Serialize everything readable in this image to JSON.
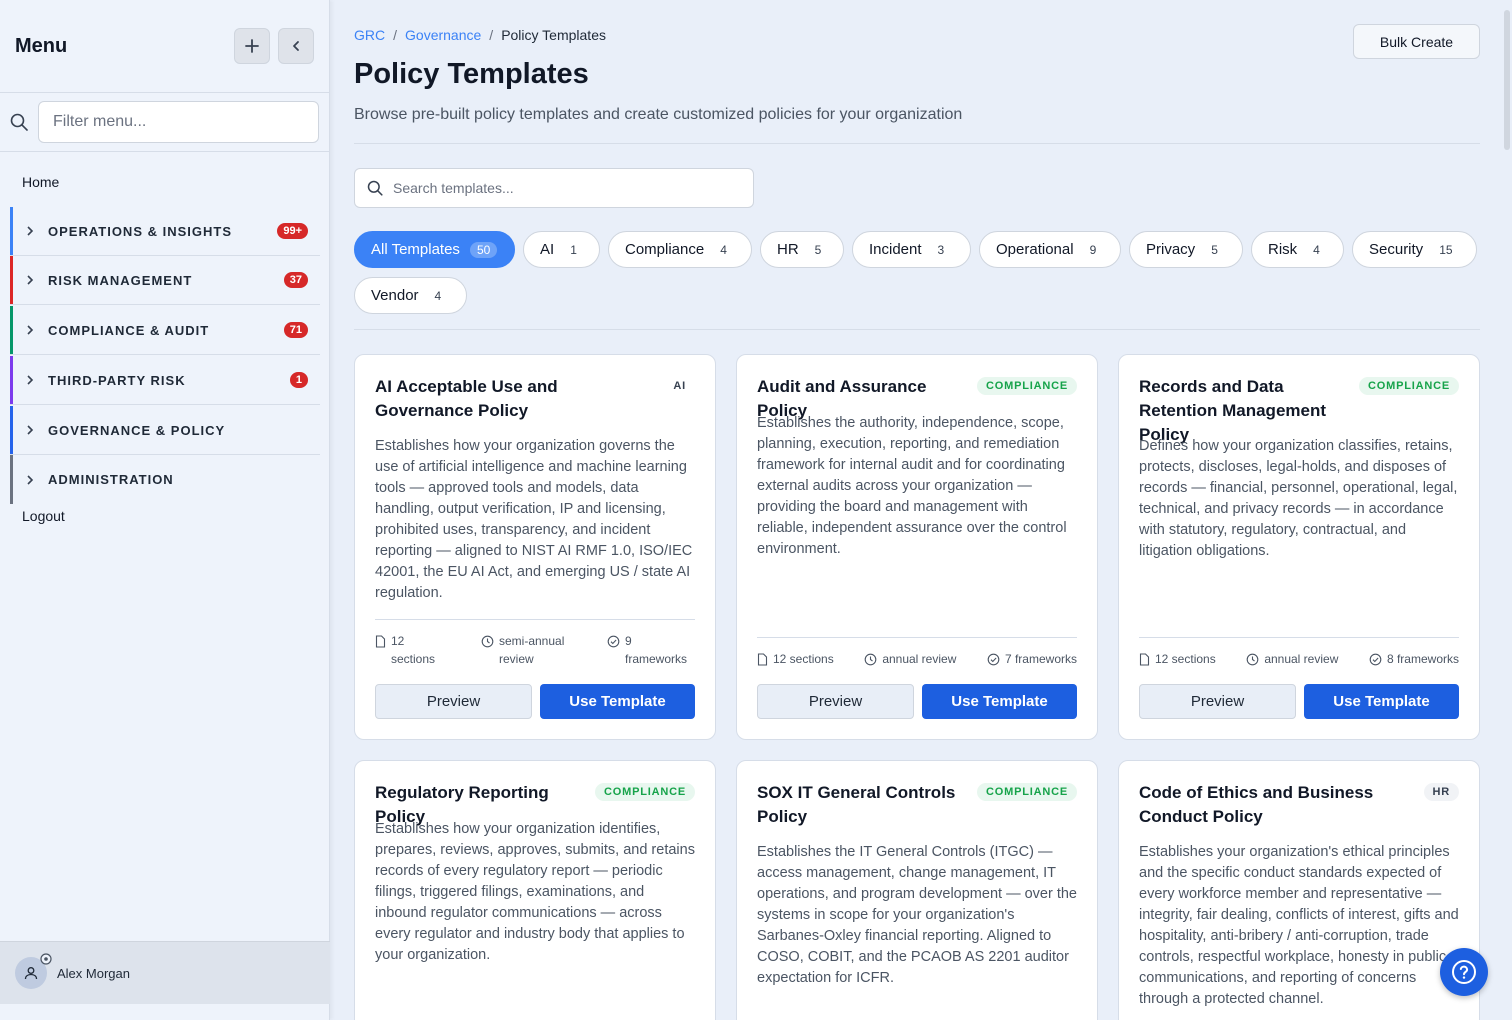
{
  "sidebar": {
    "title": "Menu",
    "filter_placeholder": "Filter menu...",
    "home": "Home",
    "sections": [
      {
        "label": "OPERATIONS & INSIGHTS",
        "badge": "99+",
        "color": "#3b82f6"
      },
      {
        "label": "RISK MANAGEMENT",
        "badge": "37",
        "color": "#dc2626"
      },
      {
        "label": "COMPLIANCE & AUDIT",
        "badge": "71",
        "color": "#059669"
      },
      {
        "label": "THIRD-PARTY RISK",
        "badge": "1",
        "color": "#7c3aed"
      },
      {
        "label": "GOVERNANCE & POLICY",
        "badge": "",
        "color": "#2563eb"
      },
      {
        "label": "ADMINISTRATION",
        "badge": "",
        "color": "#6b7280"
      }
    ],
    "logout": "Logout",
    "user": "Alex Morgan"
  },
  "breadcrumb": [
    "GRC",
    "Governance",
    "Policy Templates"
  ],
  "page": {
    "title": "Policy Templates",
    "subtitle": "Browse pre-built policy templates and create customized policies for your organization",
    "bulk_create": "Bulk Create",
    "search_placeholder": "Search templates..."
  },
  "filters": [
    {
      "label": "All Templates",
      "count": "50",
      "active": true
    },
    {
      "label": "AI",
      "count": "1"
    },
    {
      "label": "Compliance",
      "count": "4"
    },
    {
      "label": "HR",
      "count": "5"
    },
    {
      "label": "Incident",
      "count": "3"
    },
    {
      "label": "Operational",
      "count": "9"
    },
    {
      "label": "Privacy",
      "count": "5"
    },
    {
      "label": "Risk",
      "count": "4"
    },
    {
      "label": "Security",
      "count": "15"
    },
    {
      "label": "Vendor",
      "count": "4"
    }
  ],
  "cards": [
    {
      "title": "AI Acceptable Use and Governance Policy",
      "tag": "AI",
      "desc": "Establishes how your organization governs the use of artificial intelligence and machine learning tools — approved tools and models, data handling, output verification, IP and licensing, prohibited uses, transparency, and incident reporting — aligned to NIST AI RMF 1.0, ISO/IEC 42001, the EU AI Act, and emerging US / state AI regulation.",
      "sections": "12 sections",
      "review": "semi-annual review",
      "frameworks": "9 frameworks"
    },
    {
      "title": "Audit and Assurance Policy",
      "tag": "COMPLIANCE",
      "desc": "Establishes the authority, independence, scope, planning, execution, reporting, and remediation framework for internal audit and for coordinating external audits across your organization — providing the board and management with reliable, independent assurance over the control environment.",
      "sections": "12 sections",
      "review": "annual review",
      "frameworks": "7 frameworks"
    },
    {
      "title": "Records and Data Retention Management Policy",
      "tag": "COMPLIANCE",
      "desc": "Defines how your organization classifies, retains, protects, discloses, legal-holds, and disposes of records — financial, personnel, operational, legal, technical, and privacy records — in accordance with statutory, regulatory, contractual, and litigation obligations.",
      "sections": "12 sections",
      "review": "annual review",
      "frameworks": "8 frameworks"
    },
    {
      "title": "Regulatory Reporting Policy",
      "tag": "COMPLIANCE",
      "desc": "Establishes how your organization identifies, prepares, reviews, approves, submits, and retains records of every regulatory report — periodic filings, triggered filings, examinations, and inbound regulator communications — across every regulator and industry body that applies to your organization."
    },
    {
      "title": "SOX IT General Controls Policy",
      "tag": "COMPLIANCE",
      "desc": "Establishes the IT General Controls (ITGC) — access management, change management, IT operations, and program development — over the systems in scope for your organization's Sarbanes-Oxley financial reporting. Aligned to COSO, COBIT, and the PCAOB AS 2201 auditor expectation for ICFR."
    },
    {
      "title": "Code of Ethics and Business Conduct Policy",
      "tag": "HR",
      "desc": "Establishes your organization's ethical principles and the specific conduct standards expected of every workforce member and representative — integrity, fair dealing, conflicts of interest, gifts and hospitality, anti-bribery / anti-corruption, trade controls, respectful workplace, honesty in public communications, and reporting of concerns through a protected channel."
    }
  ],
  "buttons": {
    "preview": "Preview",
    "use": "Use Template"
  }
}
